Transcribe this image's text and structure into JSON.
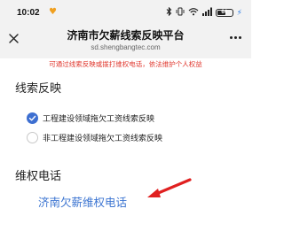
{
  "status_bar": {
    "time": "10:02",
    "battery_level": "64",
    "battery_fraction": 0.64,
    "icons": [
      "heart-icon",
      "bluetooth-icon",
      "vibrate-icon",
      "wifi-icon",
      "signal-icon",
      "battery-icon",
      "charging-icon"
    ]
  },
  "header": {
    "title": "济南市欠薪线索反映平台",
    "url": "sd.shengbangtec.com"
  },
  "notice": "可通过线索反映或拨打维权电话，依法维护个人权益",
  "clue_section": {
    "title": "线索反映",
    "options": [
      {
        "label": "工程建设领域拖欠工资线索反映",
        "checked": true
      },
      {
        "label": "非工程建设领域拖欠工资线索反映",
        "checked": false
      }
    ]
  },
  "hotline_section": {
    "title": "维权电话",
    "link": "济南欠薪维权电话"
  },
  "colors": {
    "accent": "#3d6fd1",
    "link": "#3b74d1",
    "notice_red": "#e0362c",
    "arrow_red": "#e02020"
  }
}
